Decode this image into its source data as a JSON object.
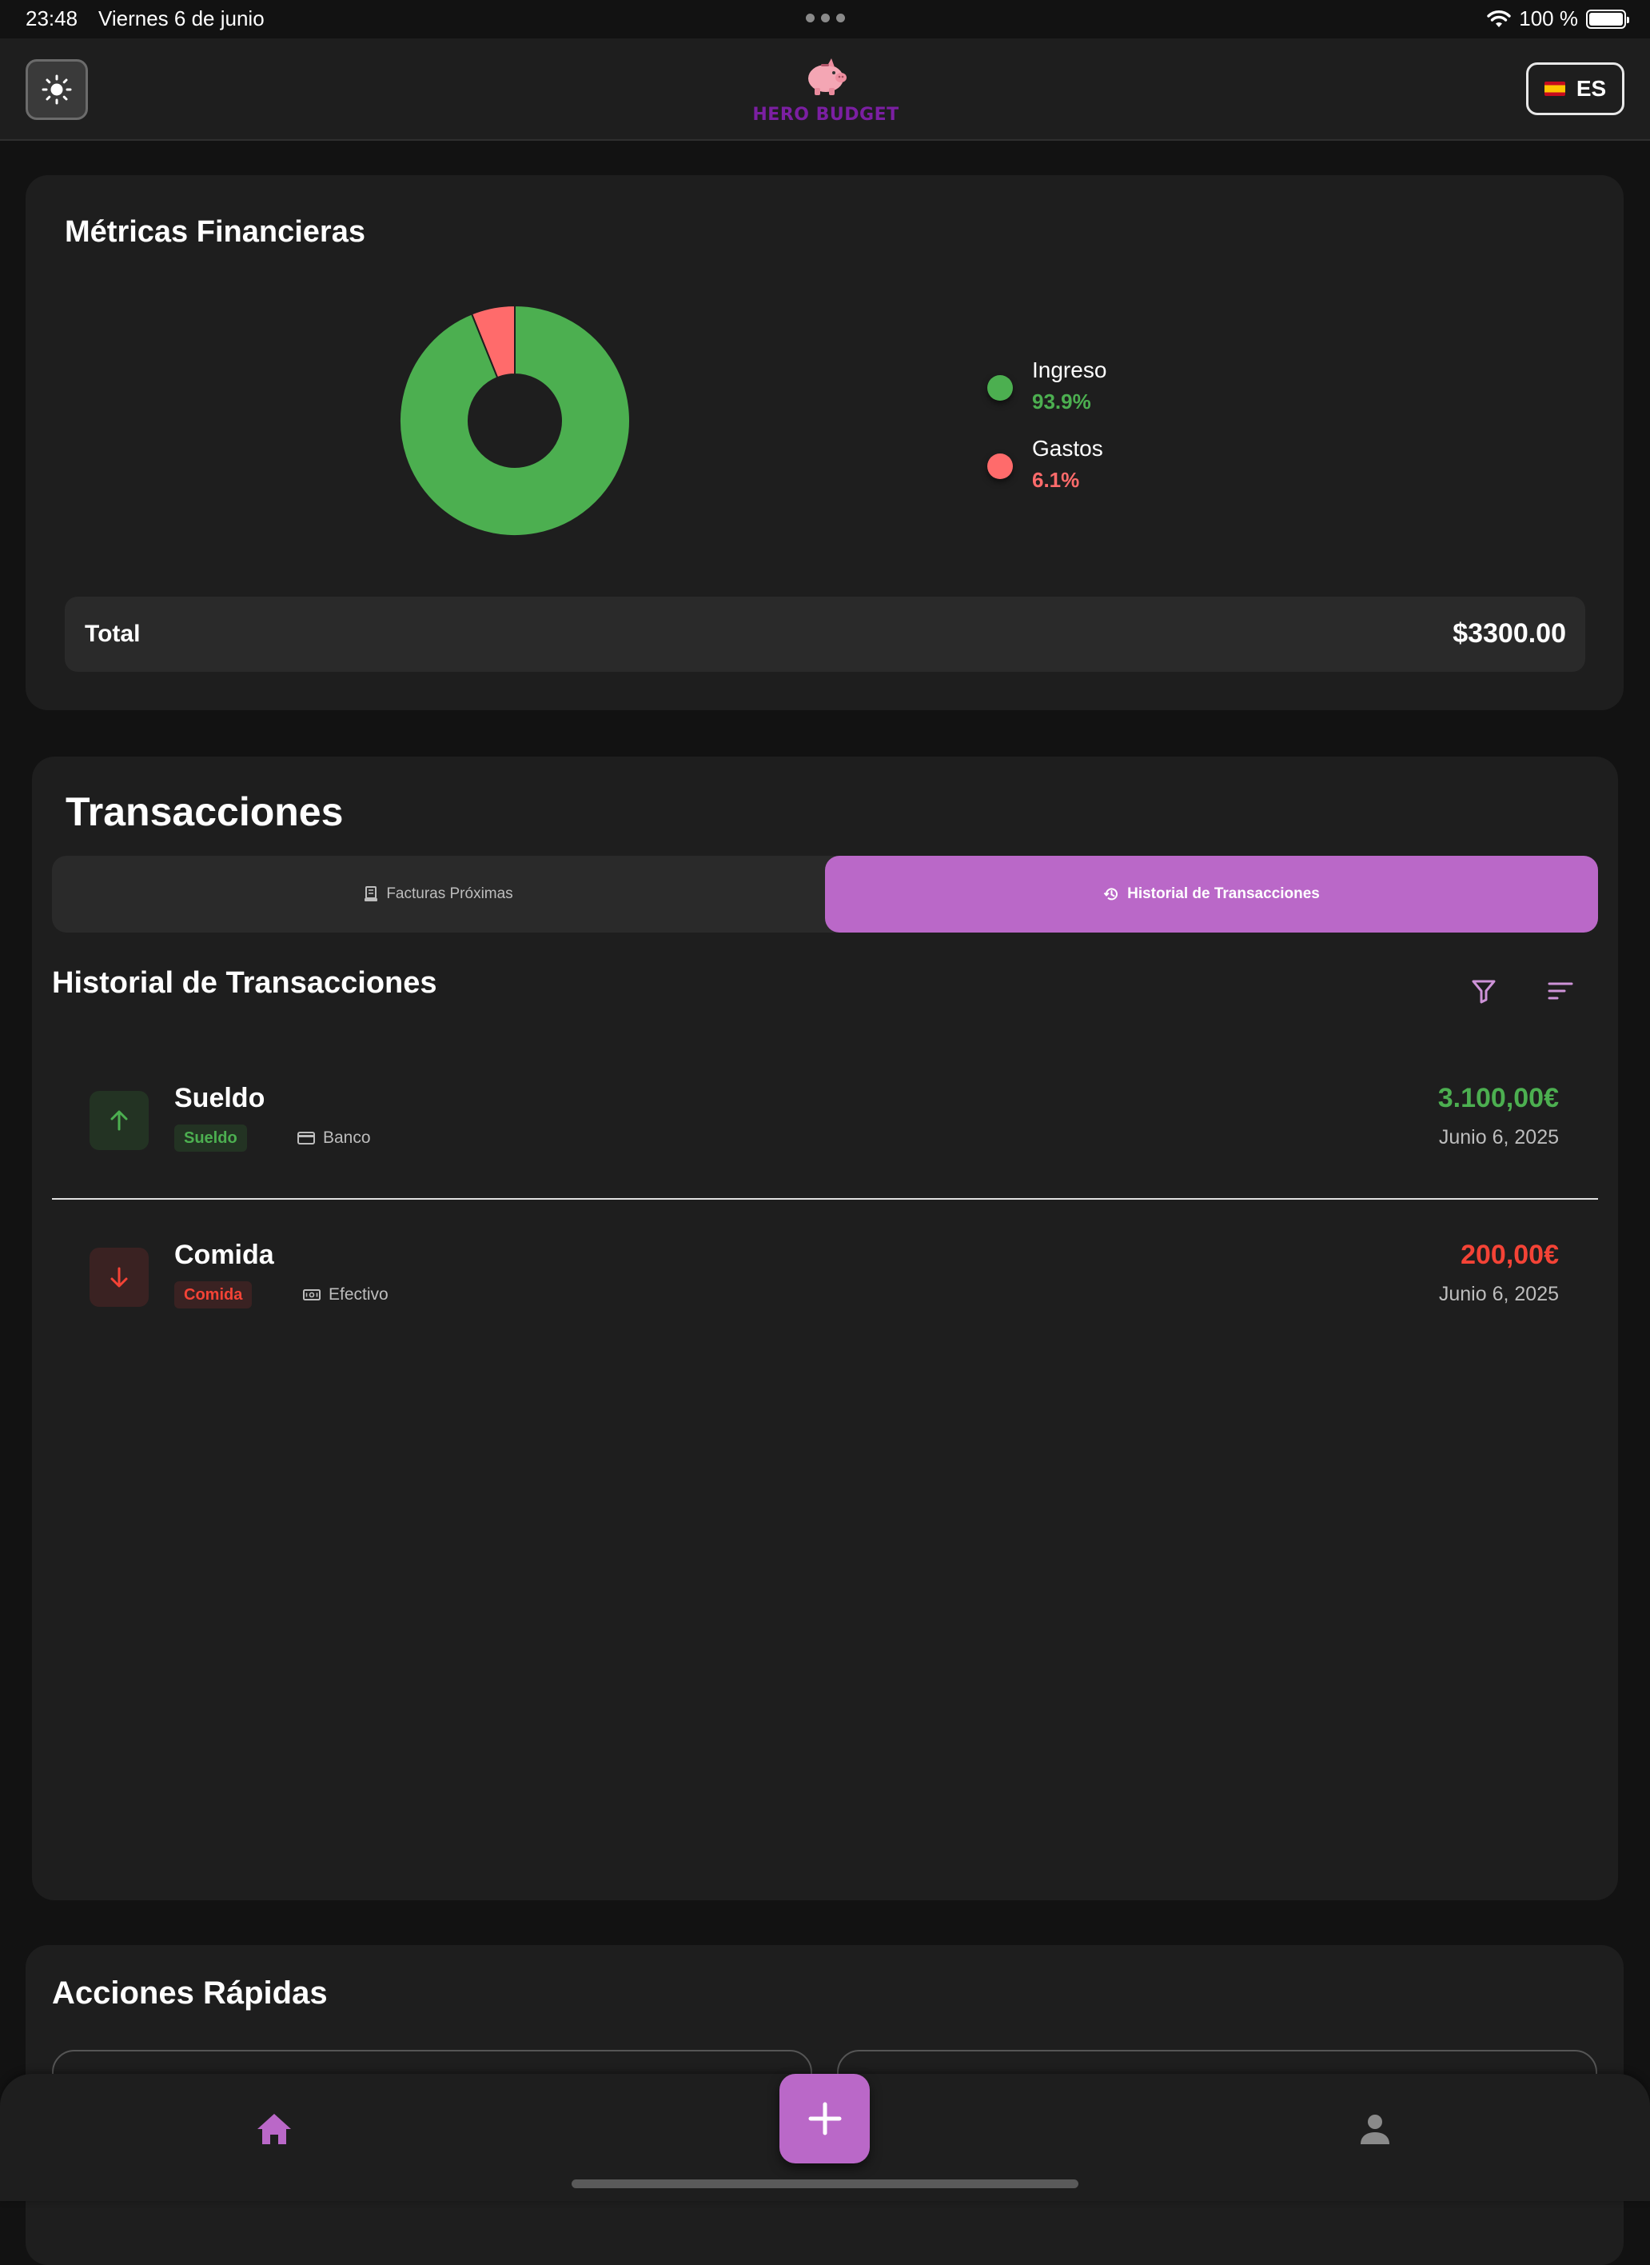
{
  "status_bar": {
    "time": "23:48",
    "date": "Viernes 6 de junio",
    "battery": "100 %"
  },
  "header": {
    "logo_text": "HERO BUDGET",
    "language_code": "ES",
    "theme_icon": "sun-icon",
    "flag_icon": "spain-flag-icon"
  },
  "metrics": {
    "title": "Métricas Financieras",
    "legend": [
      {
        "label": "Ingreso",
        "value": "93.9%",
        "color": "#4caf50"
      },
      {
        "label": "Gastos",
        "value": "6.1%",
        "color": "#ff6b6b"
      }
    ],
    "total_label": "Total",
    "total_value": "$3300.00"
  },
  "chart_data": {
    "type": "pie",
    "categories": [
      "Ingreso",
      "Gastos"
    ],
    "values": [
      93.9,
      6.1
    ],
    "colors": [
      "#4caf50",
      "#ff6b6b"
    ],
    "donut": true
  },
  "transactions": {
    "title": "Transacciones",
    "tabs": [
      {
        "label": "Facturas Próximas",
        "icon": "receipt-icon",
        "active": false
      },
      {
        "label": "Historial de Transacciones",
        "icon": "history-icon",
        "active": true
      }
    ],
    "history_title": "Historial de Transacciones",
    "filter_icon": "filter-icon",
    "sort_icon": "sort-icon",
    "items": [
      {
        "name": "Sueldo",
        "category": "Sueldo",
        "account": "Banco",
        "account_icon": "credit-card-icon",
        "amount": "3.100,00€",
        "date": "Junio 6, 2025",
        "type": "income",
        "direction_icon": "arrow-up-icon",
        "color": "#4caf50"
      },
      {
        "name": "Comida",
        "category": "Comida",
        "account": "Efectivo",
        "account_icon": "cash-icon",
        "amount": "200,00€",
        "date": "Junio 6, 2025",
        "type": "expense",
        "direction_icon": "arrow-down-icon",
        "color": "#f44336"
      }
    ]
  },
  "quick_actions": {
    "title": "Acciones Rápidas"
  },
  "bottom_nav": {
    "home_icon": "home-icon",
    "add_icon": "plus-icon",
    "profile_icon": "person-icon"
  },
  "colors": {
    "accent": "#ba68c8",
    "income": "#4caf50",
    "expense": "#f44336"
  }
}
